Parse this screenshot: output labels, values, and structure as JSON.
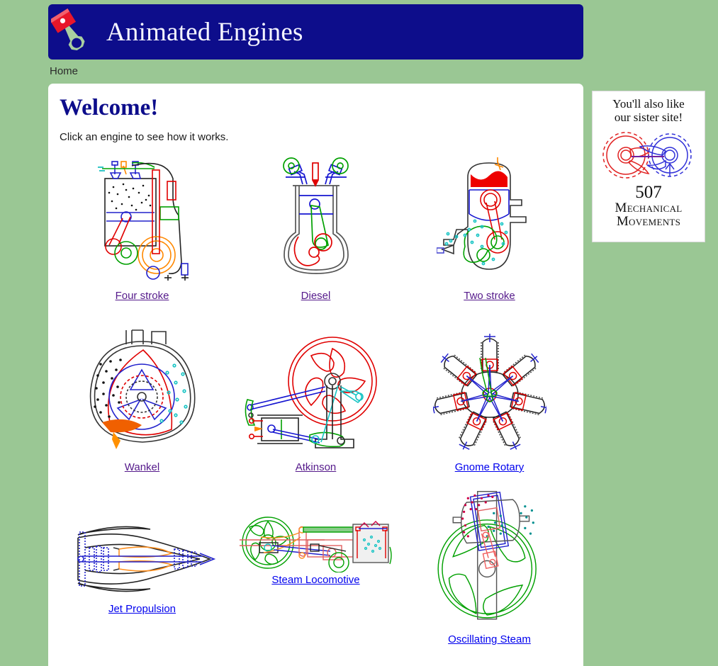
{
  "site": {
    "banner_title": "Animated Engines",
    "logo_icon": "piston-icon"
  },
  "breadcrumb": {
    "home_label": "Home"
  },
  "main": {
    "heading": "Welcome!",
    "subtitle": "Click an engine to see how it works."
  },
  "colors": {
    "page_background": "#9ac794",
    "banner_background": "#0d0d8b",
    "card_background": "#ffffff",
    "heading_color": "#0d0d8b",
    "visited_link": "#551a8b",
    "unvisited_link": "#0000ee"
  },
  "engines": [
    {
      "label": "Four stroke",
      "icon": "four-stroke-engine-icon",
      "state": "visited"
    },
    {
      "label": "Diesel",
      "icon": "diesel-engine-icon",
      "state": "visited"
    },
    {
      "label": "Two stroke",
      "icon": "two-stroke-engine-icon",
      "state": "visited"
    },
    {
      "label": "Wankel",
      "icon": "wankel-engine-icon",
      "state": "visited"
    },
    {
      "label": "Atkinson",
      "icon": "atkinson-engine-icon",
      "state": "visited"
    },
    {
      "label": "Gnome Rotary",
      "icon": "gnome-rotary-engine-icon",
      "state": "unvisited"
    },
    {
      "label": "Jet Propulsion",
      "icon": "jet-propulsion-engine-icon",
      "state": "unvisited"
    },
    {
      "label": "Steam Locomotive",
      "icon": "steam-locomotive-engine-icon",
      "state": "unvisited"
    },
    {
      "label": "Oscillating Steam",
      "icon": "oscillating-steam-engine-icon",
      "state": "unvisited"
    }
  ],
  "promo": {
    "line1": "You'll also like",
    "line2": "our sister site!",
    "number": "507",
    "name_line1": "Mechanical",
    "name_line2": "Movements",
    "icon": "two-gears-icon"
  }
}
